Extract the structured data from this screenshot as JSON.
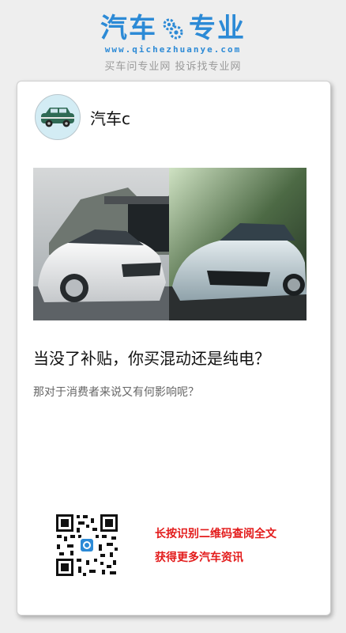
{
  "brand": {
    "logo_left": "汽车",
    "logo_right": "专业",
    "url": "www.qichezhuanye.com",
    "slogan": "买车问专业网 投诉找专业网",
    "accent_color": "#2c8ad6"
  },
  "post": {
    "author_name": "汽车c",
    "avatar_icon": "car-icon",
    "hero_image": "two-sedans-photo",
    "headline": "当没了补贴，你买混动还是纯电？",
    "subline": "那对于消费者来说又有何影响呢？"
  },
  "share": {
    "qr_icon": "qr-code-icon",
    "cta_line1": "长按识别二维码查阅全文",
    "cta_line2": "获得更多汽车资讯",
    "cta_color": "#e31b1b"
  }
}
